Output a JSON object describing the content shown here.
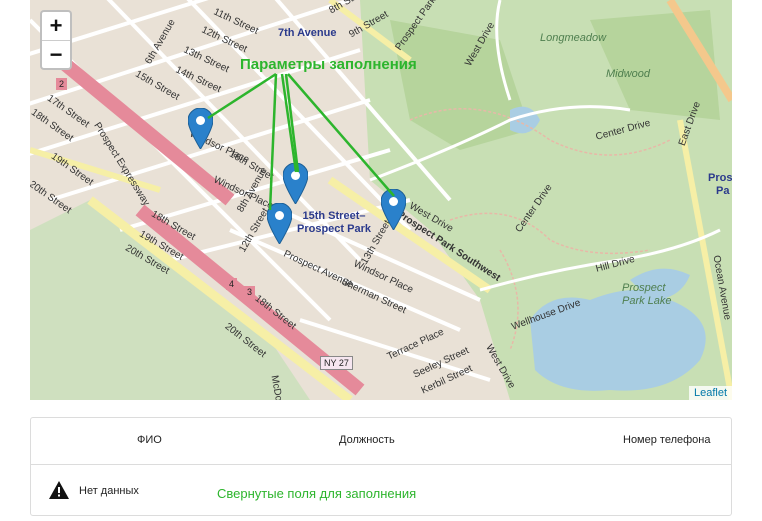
{
  "map": {
    "zoom_in": "+",
    "zoom_out": "−",
    "attribution": "Leaflet",
    "annotation": "Параметры заполнения",
    "streets": {
      "11th": "11th Street",
      "12th": "12th Street",
      "12th_b": "12th Street",
      "13th": "13th Street",
      "13th_b": "13th Street",
      "14th": "14th Street",
      "15th": "15th Street",
      "16th": "16th Street",
      "17th": "17th Street",
      "18th": "18th Street",
      "18th_b": "18th Street",
      "18th_c": "18th Street",
      "19th": "19th Street",
      "19th_b": "19th Street",
      "20th": "20th Street",
      "20th_b": "20th Street",
      "8th_st": "8th Street",
      "9th_st": "9th Street",
      "6th_ave": "6th Avenue",
      "7th_ave_st": "7th Avenue",
      "8th_ave": "8th Avenue",
      "windsor1": "Windsor Place",
      "windsor2": "Windsor Place",
      "windsor3": "Windsor Place",
      "prospect_ave": "Prospect Avenue",
      "prospect_ave2": "Prospect Avenue",
      "prospect_expy": "Prospect Expressway",
      "prospect_pk_sw": "Prospect Park Southwest",
      "prospect_pk_w": "Prospect Park W",
      "sherman": "Sherman Street",
      "terrace": "Terrace Place",
      "seeley": "Seeley Street",
      "kerbil": "Kerbil Street",
      "west_drive": "West Drive",
      "west_drive2": "West Drive",
      "west_drive3": "West Drive",
      "center_drive": "Center Drive",
      "center_drive2": "Center Drive",
      "east_drive": "East Drive",
      "hill_drive": "Hill Drive",
      "wellhouse": "Wellhouse Drive",
      "ocean_ave": "Ocean Avenue",
      "mcdo": "McDo"
    },
    "places": {
      "seventh_ave": "7th Avenue",
      "station": "15th Street–Prospect Park",
      "prospect_label": "Prospect",
      "park_label": "Park",
      "longmeadow": "Longmeadow",
      "midwood": "Midwood",
      "lake": "Prospect Park Lake",
      "lake_a": "Prospect",
      "lake_b": "Park Lake",
      "prospect_right": "Prosp",
      "park_right": "Pa"
    },
    "shields": {
      "ny27": "NY 27",
      "exit2": "2",
      "exit3": "3",
      "exit4": "4"
    }
  },
  "table": {
    "columns": {
      "name": "ФИО",
      "position": "Должность",
      "phone": "Номер телефона"
    },
    "empty_text": "Нет данных",
    "collapsed_note": "Свернутые поля для заполнения"
  }
}
